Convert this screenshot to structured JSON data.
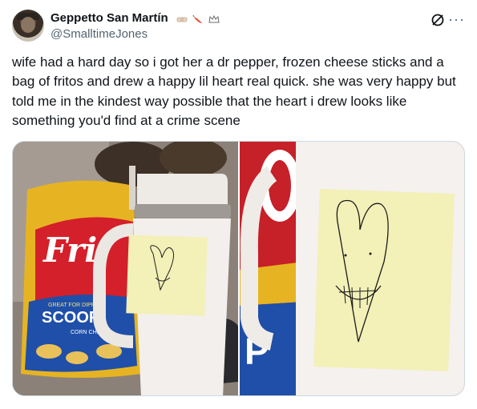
{
  "author": {
    "display_name": "Geppetto San Martín",
    "handle": "@SmalltimeJones",
    "name_emojis": [
      "bandage-icon",
      "pepper-icon",
      "crown-icon"
    ]
  },
  "header_icons": {
    "grok": "grok-icon",
    "more": "more-options-icon",
    "more_glyph": "···"
  },
  "tweet": {
    "text": "wife had a hard day so i got her a dr pepper, frozen cheese sticks and a bag of fritos and drew a happy lil heart real quick. she was very happy but told me in the kindest way possible that the heart i drew looks like something you'd find at a crime scene"
  },
  "media": {
    "count": 2,
    "bag_brand_text": "Fri",
    "bag_product_text": "SCOOP",
    "bag_sub_text": "CORN CHIPS",
    "bag_banner_text": "GREAT FOR DIPPING"
  },
  "colors": {
    "text_primary": "#0f1419",
    "text_secondary": "#536471",
    "border": "#cfd9de",
    "sticky_note": "#f3f0b8"
  }
}
